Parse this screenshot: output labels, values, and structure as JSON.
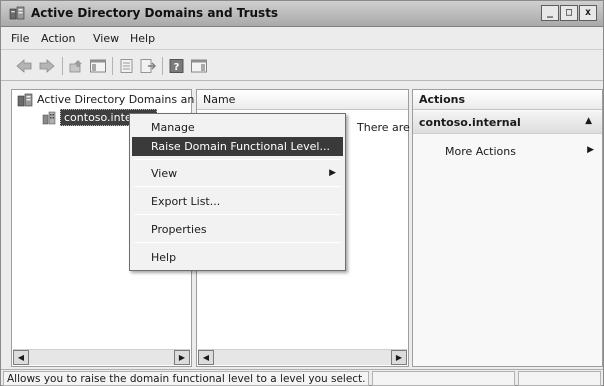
{
  "window": {
    "title": "Active Directory Domains and Trusts",
    "icon": "ad-domains-trusts-icon",
    "controls": {
      "minimize": "_",
      "maximize": "□",
      "close": "x"
    }
  },
  "menubar": {
    "items": [
      "File",
      "Action",
      "View",
      "Help"
    ]
  },
  "toolbar": {
    "buttons": [
      "back-icon",
      "forward-icon",
      "up-icon",
      "show-hide-tree-icon",
      "properties-icon",
      "export-list-icon",
      "help-icon",
      "show-hide-action-pane-icon"
    ]
  },
  "tree": {
    "root_label": "Active Directory Domains an",
    "child_label": "contoso.internal"
  },
  "list": {
    "column_header": "Name",
    "empty_message": "There are no items to show in this view."
  },
  "actions": {
    "header": "Actions",
    "section_title": "contoso.internal",
    "more_actions": "More Actions"
  },
  "context_menu": {
    "items": [
      {
        "label": "Manage"
      },
      {
        "label": "Raise Domain Functional Level..."
      },
      {
        "label": "View"
      },
      {
        "label": "Export List..."
      },
      {
        "label": "Properties"
      },
      {
        "label": "Help"
      }
    ]
  },
  "statusbar": {
    "text": "Allows you to raise the domain functional level to a level you select."
  },
  "colors": {
    "highlight": "#3a3a3a",
    "title_gradient_top": "#cfcfcf",
    "window_bg": "#ececec"
  }
}
